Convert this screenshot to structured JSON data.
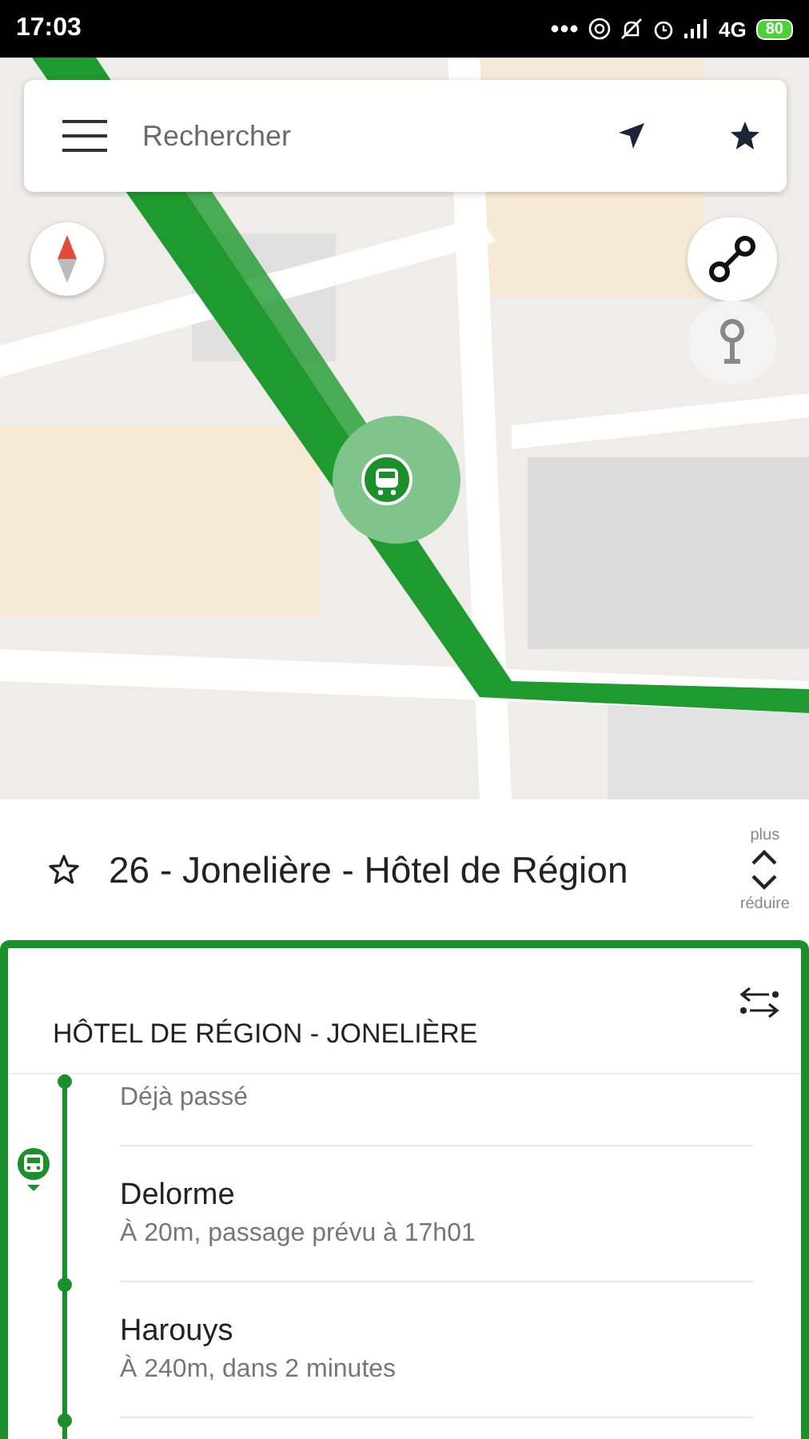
{
  "status_bar": {
    "time": "17:03",
    "network": "4G",
    "battery": "80"
  },
  "search": {
    "placeholder": "Rechercher"
  },
  "map_modes": [
    {
      "kind": "route",
      "selected": true
    },
    {
      "kind": "stop",
      "selected": false
    }
  ],
  "line": {
    "title": "26 - Jonelière - Hôtel de Région",
    "favorite": false,
    "more_label": "plus",
    "less_label": "réduire"
  },
  "direction": {
    "title": "HÔTEL DE RÉGION - JONELIÈRE"
  },
  "stops": [
    {
      "kind": "passed",
      "name": "Déjà passé",
      "bus_before": false
    },
    {
      "kind": "stop",
      "name": "Delorme",
      "detail": "À 20m, passage prévu à 17h01",
      "bus_before": true
    },
    {
      "kind": "stop",
      "name": "Harouys",
      "detail": "À 240m, dans 2 minutes",
      "bus_before": false
    }
  ]
}
